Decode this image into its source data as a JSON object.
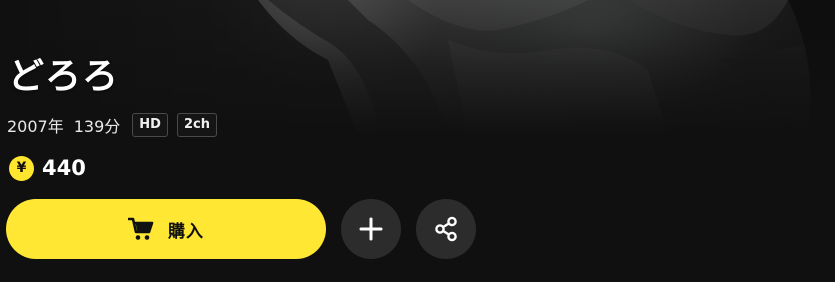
{
  "title": "どろろ",
  "meta": {
    "year": "2007年",
    "duration": "139分",
    "badges": [
      "HD",
      "2ch"
    ]
  },
  "price": {
    "currency_symbol": "¥",
    "value": "440"
  },
  "actions": {
    "buy_label": "購入"
  },
  "icons": {
    "coin": "coin-icon",
    "cart": "cart-icon",
    "add": "plus-icon",
    "share": "share-icon"
  },
  "colors": {
    "accent": "#FFE733",
    "background": "#101010",
    "round_button": "#2C2C2C"
  }
}
